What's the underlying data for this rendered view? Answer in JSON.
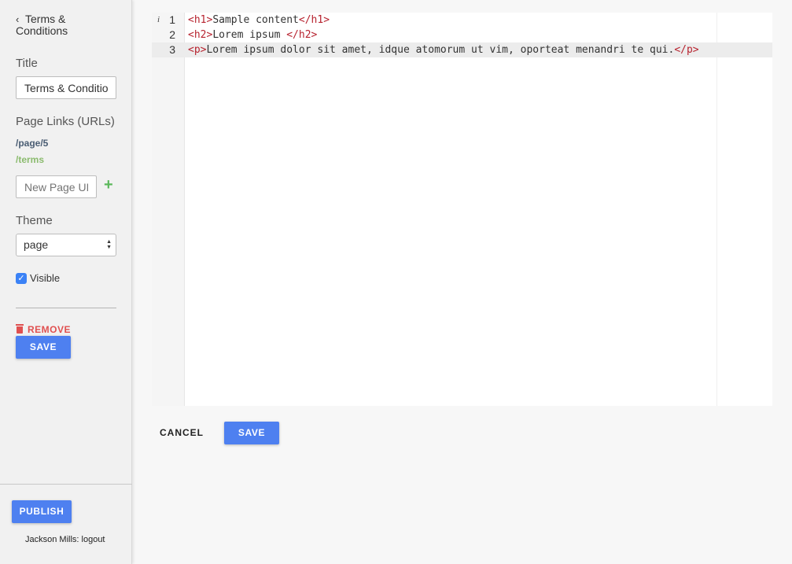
{
  "sidebar": {
    "back_line1": "Terms &",
    "back_line2": "Conditions",
    "title_label": "Title",
    "title_value": "Terms & Conditions",
    "page_links_label": "Page Links (URLs)",
    "links": [
      "/page/5",
      "/terms"
    ],
    "link_colors": [
      "#4a5d73",
      "#8bbb6e"
    ],
    "new_link_placeholder": "New Page URL",
    "theme_label": "Theme",
    "theme_value": "page",
    "visible_label": "Visible",
    "visible_checked": true,
    "remove_label": "REMOVE",
    "save_label": "SAVE",
    "publish_label": "PUBLISH",
    "user_text": "Jackson Mills: logout"
  },
  "editor": {
    "lines": [
      {
        "num": "1",
        "open": "<h1>",
        "text": "Sample content",
        "close": "</h1>",
        "info": "i"
      },
      {
        "num": "2",
        "open": "<h2>",
        "text": "Lorem ipsum ",
        "close": "</h2>"
      },
      {
        "num": "3",
        "open": "<p>",
        "text": "Lorem ipsum dolor sit amet, idque atomorum ut vim, oporteat menandri te qui.",
        "close": "</p>",
        "active": true
      }
    ]
  },
  "actions": {
    "cancel_label": "CANCEL",
    "save_label": "SAVE"
  },
  "colors": {
    "accent": "#4e80f0",
    "danger": "#e05050",
    "tag": "#b7232f"
  }
}
